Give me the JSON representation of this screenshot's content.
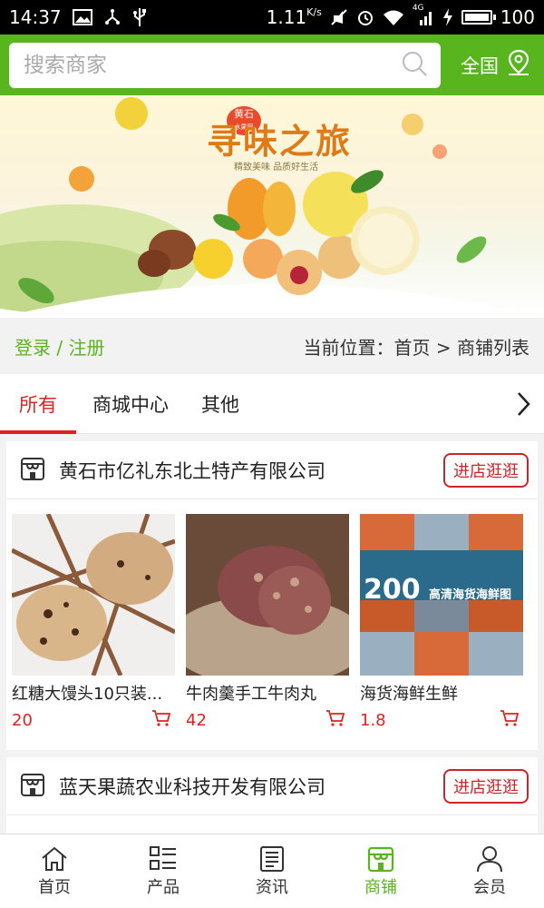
{
  "status_bar": {
    "time": "14:37",
    "speed": "1.11",
    "speed_unit": "K/s",
    "network": "4G",
    "battery": "100",
    "icons": [
      "image-icon",
      "usb-share-icon",
      "usb-icon",
      "mute-icon",
      "alarm-icon",
      "wifi-icon",
      "signal-icon",
      "charging-icon",
      "battery-icon"
    ]
  },
  "header": {
    "search_placeholder": "搜索商家",
    "region_label": "全国",
    "accent_color": "#58b51d"
  },
  "banner": {
    "title": "寻味之旅",
    "badge_line1": "黄石",
    "badge_line2": "水果网",
    "subtitle": "精致美味 品质好生活"
  },
  "breadcrumb": {
    "login_register": "登录 / 注册",
    "location": "当前位置：首页 > 商铺列表"
  },
  "tabs": [
    {
      "label": "所有",
      "active": true
    },
    {
      "label": "商城中心",
      "active": false
    },
    {
      "label": "其他",
      "active": false
    }
  ],
  "shops": [
    {
      "name": "黄石市亿礼东北土特产有限公司",
      "enter_label": "进店逛逛",
      "products": [
        {
          "name": "红糖大馒头10只装...",
          "price": "20"
        },
        {
          "name": "牛肉羹手工牛肉丸",
          "price": "42"
        },
        {
          "name": "海货海鲜生鲜",
          "price": "1.8",
          "image_text": "200",
          "image_caption": "高清海货海鲜图"
        }
      ]
    },
    {
      "name": "蓝天果蔬农业科技开发有限公司",
      "enter_label": "进店逛逛",
      "products": []
    }
  ],
  "bottom_nav": [
    {
      "label": "首页",
      "icon": "home-icon",
      "active": false
    },
    {
      "label": "产品",
      "icon": "list-icon",
      "active": false
    },
    {
      "label": "资讯",
      "icon": "news-icon",
      "active": false
    },
    {
      "label": "商铺",
      "icon": "shop-icon",
      "active": true
    },
    {
      "label": "会员",
      "icon": "user-icon",
      "active": false
    }
  ]
}
